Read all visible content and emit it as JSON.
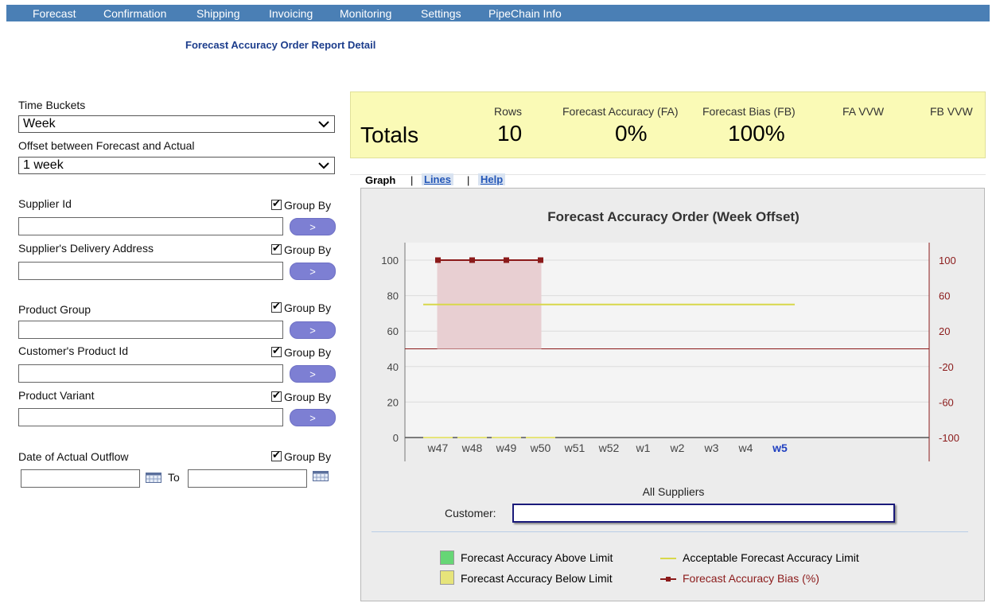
{
  "nav": [
    "Forecast",
    "Confirmation",
    "Shipping",
    "Invoicing",
    "Monitoring",
    "Settings",
    "PipeChain Info"
  ],
  "page_title": "Forecast Accuracy Order Report Detail",
  "filters": {
    "time_buckets_label": "Time Buckets",
    "time_buckets_value": "Week",
    "offset_label": "Offset between Forecast and Actual",
    "offset_value": "1 week",
    "group_by_label": "Group By",
    "go_label": ">",
    "supplier_id_label": "Supplier Id",
    "supplier_address_label": "Supplier's Delivery Address",
    "product_group_label": "Product Group",
    "customer_product_label": "Customer's Product Id",
    "product_variant_label": "Product Variant",
    "date_outflow_label": "Date of Actual Outflow",
    "to_label": "To"
  },
  "totals": {
    "label": "Totals",
    "rows_header": "Rows",
    "rows_value": "10",
    "fa_header": "Forecast Accuracy (FA)",
    "fa_value": "0%",
    "fb_header": "Forecast Bias (FB)",
    "fb_value": "100%",
    "fa_vvw_header": "FA VVW",
    "fb_vvw_header": "FB VVW"
  },
  "tabs": {
    "graph": "Graph",
    "lines": "Lines",
    "help": "Help",
    "sep": "|"
  },
  "chart_data": {
    "type": "bar",
    "title": "Forecast Accuracy Order (Week Offset)",
    "categories": [
      "w47",
      "w48",
      "w49",
      "w50",
      "w51",
      "w52",
      "w1",
      "w2",
      "w3",
      "w4",
      "w5"
    ],
    "highlight_category": "w5",
    "y_left": {
      "ticks": [
        0,
        20,
        40,
        60,
        80,
        100
      ],
      "ylim": [
        0,
        100
      ]
    },
    "y_right": {
      "ticks": [
        -100,
        -60,
        -20,
        20,
        60,
        100
      ],
      "ylim": [
        -100,
        100
      ]
    },
    "series": [
      {
        "name": "Forecast Accuracy Below Limit",
        "axis": "left",
        "values": [
          0,
          0,
          0,
          0,
          null,
          null,
          null,
          null,
          null,
          null,
          null
        ],
        "color": "#e6e47a"
      },
      {
        "name": "Acceptable Forecast Accuracy Limit",
        "axis": "left",
        "values": [
          75,
          75,
          75,
          75,
          75,
          75,
          75,
          75,
          75,
          75,
          75
        ],
        "color": "#d8d84a"
      },
      {
        "name": "Forecast Accuracy Bias (%)",
        "axis": "right",
        "values": [
          100,
          100,
          100,
          100,
          null,
          null,
          null,
          null,
          null,
          null,
          null
        ],
        "color": "#8b1a1a"
      }
    ],
    "subtitle": "All Suppliers",
    "grid": true
  },
  "customer_label": "Customer:",
  "customer_value": "",
  "legend": {
    "above": "Forecast Accuracy Above Limit",
    "below": "Forecast Accuracy Below Limit",
    "limit": "Acceptable Forecast Accuracy Limit",
    "bias": "Forecast Accuracy Bias (%)"
  },
  "colors": {
    "nav_bg": "#4a7fb5",
    "title": "#1c3d8c",
    "totals_bg": "#fafab6",
    "above": "#66d675",
    "below": "#e6e47a",
    "bias": "#8b1a1a",
    "highlight": "#2040c0"
  }
}
